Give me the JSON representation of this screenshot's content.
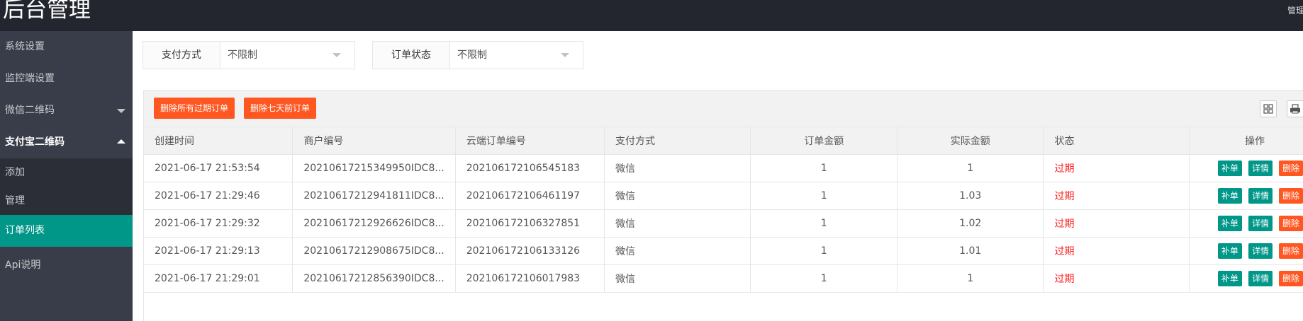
{
  "header": {
    "logo": "后台管理",
    "user_menu": "管理"
  },
  "sidebar": {
    "items": [
      {
        "label": "系统设置"
      },
      {
        "label": "监控端设置"
      },
      {
        "label": "微信二维码"
      },
      {
        "label": "支付宝二维码"
      },
      {
        "label": "添加"
      },
      {
        "label": "管理"
      },
      {
        "label": "订单列表"
      },
      {
        "label": "Api说明"
      }
    ]
  },
  "filters": {
    "payment_label": "支付方式",
    "payment_value": "不限制",
    "status_label": "订单状态",
    "status_value": "不限制"
  },
  "toolbar": {
    "delete_expired": "删除所有过期订单",
    "delete_week": "删除七天前订单"
  },
  "table": {
    "headers": [
      "创建时间",
      "商户编号",
      "云端订单编号",
      "支付方式",
      "订单金额",
      "实际金额",
      "状态",
      "操作"
    ],
    "rows": [
      {
        "time": "2021-06-17 21:53:54",
        "merchant": "20210617215349950IDC8...",
        "cloud": "202106172106545183",
        "pay": "微信",
        "amount": "1",
        "actual": "1",
        "status": "过期"
      },
      {
        "time": "2021-06-17 21:29:46",
        "merchant": "20210617212941811IDC8...",
        "cloud": "202106172106461197",
        "pay": "微信",
        "amount": "1",
        "actual": "1.03",
        "status": "过期"
      },
      {
        "time": "2021-06-17 21:29:32",
        "merchant": "20210617212926626IDC8...",
        "cloud": "202106172106327851",
        "pay": "微信",
        "amount": "1",
        "actual": "1.02",
        "status": "过期"
      },
      {
        "time": "2021-06-17 21:29:13",
        "merchant": "20210617212908675IDC8...",
        "cloud": "202106172106133126",
        "pay": "微信",
        "amount": "1",
        "actual": "1.01",
        "status": "过期"
      },
      {
        "time": "2021-06-17 21:29:01",
        "merchant": "20210617212856390IDC8...",
        "cloud": "202106172106017983",
        "pay": "微信",
        "amount": "1",
        "actual": "1",
        "status": "过期"
      }
    ],
    "actions": {
      "repair": "补单",
      "detail": "详情",
      "delete": "删除"
    }
  },
  "colors": {
    "header_bg": "#23262e",
    "sidebar_bg": "#393d49",
    "accent_green": "#009688",
    "accent_orange": "#ff5722",
    "status_red": "#ff1f1f"
  },
  "icons": [
    "columns-icon",
    "print-icon",
    "caret-down-icon",
    "caret-up-icon",
    "select-arrow-icon"
  ]
}
